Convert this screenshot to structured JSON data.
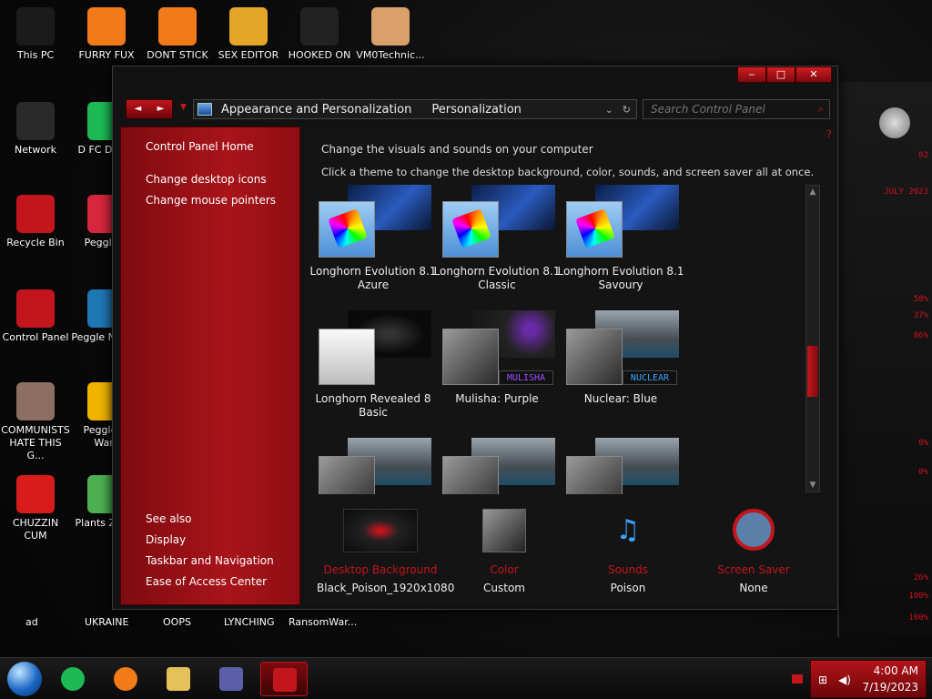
{
  "desktop": {
    "icons": [
      {
        "label": "This PC",
        "color": "#1b1b1b"
      },
      {
        "label": "FURRY FUX",
        "color": "#f07b18"
      },
      {
        "label": "DONT STICK",
        "color": "#f07b18"
      },
      {
        "label": "SEX EDITOR",
        "color": "#e5a528"
      },
      {
        "label": "HOOKED ON",
        "color": "#222222"
      },
      {
        "label": "VM0Technic...",
        "color": "#d9a06c"
      },
      {
        "label": "Network",
        "color": "#2a2a2a"
      },
      {
        "label": "D FC DUMB",
        "color": "#1db954"
      },
      {
        "label": "Recycle Bin",
        "color": "#c3151c"
      },
      {
        "label": "Peggle D",
        "color": "#d7263d"
      },
      {
        "label": "Control Panel",
        "color": "#c3151c"
      },
      {
        "label": "Peggle N Delu",
        "color": "#1f77b4"
      },
      {
        "label": "COMMUNISTS HATE THIS G...",
        "color": "#8d6e63"
      },
      {
        "label": "Peggle of Warc",
        "color": "#f0b400"
      },
      {
        "label": "CHUZZIN CUM",
        "color": "#d81b1b"
      },
      {
        "label": "Plants Zomb",
        "color": "#4caf50"
      }
    ],
    "bottom_labels": [
      "ad",
      "UKRAINE",
      "OOPS",
      "LYNCHING",
      "RansomWar..."
    ]
  },
  "window": {
    "caption": {
      "minimize": "‒",
      "maximize": "□",
      "close": "✕"
    },
    "nav": {
      "back": "◄",
      "forward": "►",
      "dropdown": "▼"
    },
    "breadcrumb": [
      "Appearance and Personalization",
      "Personalization"
    ],
    "address_dropdown": "⌄",
    "refresh": "↻",
    "search": {
      "placeholder": "Search Control Panel",
      "icon": "⌕"
    },
    "help": "?"
  },
  "sidebar": {
    "home": "Control Panel Home",
    "links": [
      "Change desktop icons",
      "Change mouse pointers"
    ],
    "see_also_header": "See also",
    "see_also": [
      "Display",
      "Taskbar and Navigation",
      "Ease of Access Center"
    ]
  },
  "main": {
    "title": "Change the visuals and sounds on your computer",
    "subtitle": "Click a theme to change the desktop background, color, sounds, and screen saver all at once.",
    "themes": [
      {
        "label": "Longhorn Evolution 8.1 Azure",
        "style": "blue"
      },
      {
        "label": "Longhorn Evolution 8.1 Classic",
        "style": "blue"
      },
      {
        "label": "Longhorn Evolution 8.1 Savoury",
        "style": "blue"
      },
      {
        "label": "Longhorn Revealed 8 Basic",
        "style": "white"
      },
      {
        "label": "Mulisha: Purple",
        "style": "grey",
        "tag": "MULISHA",
        "tag_color": "#9b4dff"
      },
      {
        "label": "Nuclear: Blue",
        "style": "grey",
        "tag": "NUCLEAR",
        "tag_color": "#3aa3ff"
      },
      {
        "label": "",
        "style": "grey"
      },
      {
        "label": "",
        "style": "grey"
      },
      {
        "label": "",
        "style": "grey"
      }
    ],
    "bottom": [
      {
        "label": "Desktop Background",
        "value": "Black_Poison_1920x1080"
      },
      {
        "label": "Color",
        "value": "Custom"
      },
      {
        "label": "Sounds",
        "value": "Poison"
      },
      {
        "label": "Screen Saver",
        "value": "None"
      }
    ]
  },
  "taskbar": {
    "time": "4:00 AM",
    "date": "7/19/2023",
    "buttons": [
      {
        "name": "spotify",
        "color": "#1db954"
      },
      {
        "name": "firefox",
        "color": "#f07b18"
      },
      {
        "name": "file-explorer",
        "color": "#e5c15a"
      },
      {
        "name": "control-panel-window",
        "color": "#5b5fa8"
      },
      {
        "name": "personalization-window",
        "color": "#c3151c"
      }
    ]
  },
  "widget": {
    "readouts": [
      "02",
      "JULY 2023",
      "58%",
      "37%",
      "86%",
      "0%",
      "0%",
      "26%",
      "100%",
      "100%"
    ]
  },
  "colors": {
    "accent": "#c3151c",
    "sidebar": "#a8141a"
  }
}
